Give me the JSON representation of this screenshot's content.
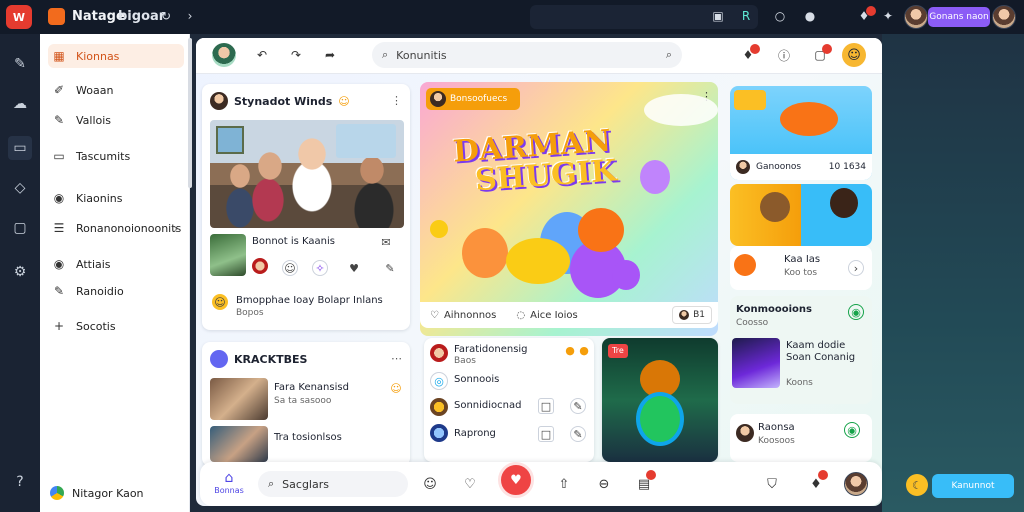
{
  "app": {
    "logo_text": "W",
    "brand": "Natage",
    "brand_sub": "bigoar"
  },
  "topbar": {
    "pill_label": "Gonans naon"
  },
  "sidebar": {
    "items": [
      {
        "label": "Kionnas",
        "icon": "grid-icon"
      },
      {
        "label": "Woaan",
        "icon": "edit-icon"
      },
      {
        "label": "Vallois",
        "icon": "pen-icon"
      },
      {
        "label": "Tascumits",
        "icon": "box-icon"
      },
      {
        "label": "Kiaonins",
        "icon": "pin-icon"
      },
      {
        "label": "Ronanonoionoonits",
        "icon": "list-icon"
      },
      {
        "label": "Attiais",
        "icon": "pin-icon"
      },
      {
        "label": "Ranoidio",
        "icon": "pen-icon"
      },
      {
        "label": "Socotis",
        "icon": "plus-icon"
      }
    ],
    "footer_label": "Nitagor Kaon"
  },
  "main": {
    "search_placeholder": "Konunitis",
    "card_family": {
      "title": "Stynadot Winds",
      "row_title": "Bonnot is Kaanis",
      "row_footer": "Bmopphae Ioay  Bolapr Inlans",
      "row_footer_sub": "Bopos"
    },
    "card_kr": {
      "title": "KRACKTBES",
      "rows": [
        {
          "title": "Fara Kenansisd",
          "sub": "Sa ta sasooo"
        },
        {
          "title": "Tra tosionlsos"
        }
      ]
    },
    "hero": {
      "pill_label": "Bonsoofuecs",
      "title_line1": "DARMAN",
      "title_line2": "SHUGIK",
      "foot_left": "Aihnonnos",
      "foot_mid": "Aice Ioios",
      "foot_count": "B1"
    },
    "list_card": {
      "rows": [
        {
          "title": "Faratidonensig",
          "sub": "Baos",
          "icon": "avatar"
        },
        {
          "title": "Sonnoois",
          "icon": "shield-icon"
        },
        {
          "title": "Sonnidiocnad",
          "icon": "avatar"
        },
        {
          "title": "Raprong",
          "icon": "avatar"
        }
      ]
    },
    "game_card": {
      "badge": "Tre"
    },
    "right": {
      "card1": {
        "row": "Ganoonos",
        "count": "10 1634"
      },
      "card3": {
        "title": "Kaa Ias",
        "sub": "Koo tos"
      },
      "card4": {
        "title": "Konmoooions",
        "sub": "Coosso"
      },
      "card5": {
        "title": "Kaam dodie",
        "line2": "Soan Conanig",
        "sub": "Koons"
      },
      "card6": {
        "title": "Raonsa",
        "sub": "Koosoos"
      }
    }
  },
  "bottom": {
    "home_label": "Bonnas",
    "search_placeholder": "Sacglars"
  },
  "float": {
    "pill_label": "Kanunnot"
  },
  "colors": {
    "accent": "#d2541a",
    "record": "#ef4444",
    "purple": "#8b5cf6",
    "sky": "#38bdf8"
  }
}
